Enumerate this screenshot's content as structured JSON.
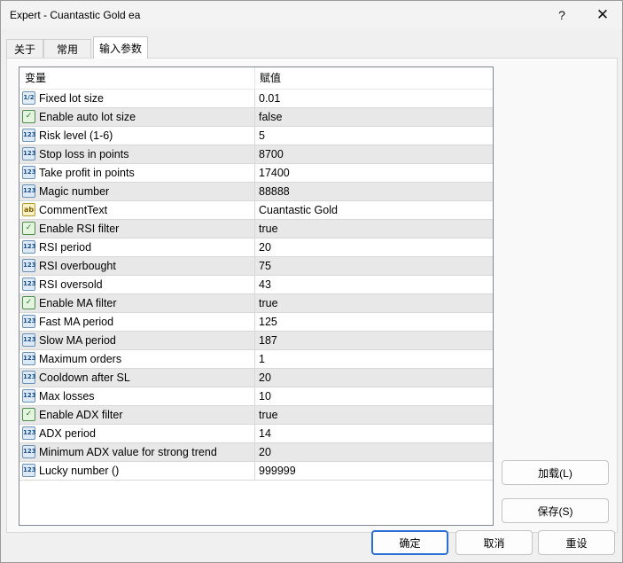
{
  "window": {
    "title": "Expert - Cuantastic Gold ea",
    "help": "?",
    "close": "✕"
  },
  "tabs": [
    "关于",
    "常用",
    "输入参数"
  ],
  "grid": {
    "headers": {
      "variable": "变量",
      "value": "赋值"
    },
    "rows": [
      {
        "type": "frac",
        "icon": "1/2",
        "name": "Fixed lot size",
        "value": "0.01"
      },
      {
        "type": "bool",
        "icon": "✓",
        "name": "Enable auto lot size",
        "value": "false"
      },
      {
        "type": "num",
        "icon": "123",
        "name": "Risk level (1-6)",
        "value": "5"
      },
      {
        "type": "num",
        "icon": "123",
        "name": "Stop loss in points",
        "value": "8700"
      },
      {
        "type": "num",
        "icon": "123",
        "name": "Take profit in points",
        "value": "17400"
      },
      {
        "type": "num",
        "icon": "123",
        "name": "Magic number",
        "value": "88888"
      },
      {
        "type": "str",
        "icon": "ab",
        "name": "CommentText",
        "value": "Cuantastic Gold"
      },
      {
        "type": "bool",
        "icon": "✓",
        "name": "Enable RSI filter",
        "value": "true"
      },
      {
        "type": "num",
        "icon": "123",
        "name": "RSI period",
        "value": "20"
      },
      {
        "type": "num",
        "icon": "123",
        "name": "RSI overbought",
        "value": "75"
      },
      {
        "type": "num",
        "icon": "123",
        "name": "RSI oversold",
        "value": "43"
      },
      {
        "type": "bool",
        "icon": "✓",
        "name": "Enable MA filter",
        "value": "true"
      },
      {
        "type": "num",
        "icon": "123",
        "name": "Fast MA period",
        "value": "125"
      },
      {
        "type": "num",
        "icon": "123",
        "name": "Slow MA period",
        "value": "187"
      },
      {
        "type": "num",
        "icon": "123",
        "name": "Maximum orders",
        "value": "1"
      },
      {
        "type": "num",
        "icon": "123",
        "name": "Cooldown after SL",
        "value": "20"
      },
      {
        "type": "num",
        "icon": "123",
        "name": "Max losses",
        "value": "10"
      },
      {
        "type": "bool",
        "icon": "✓",
        "name": "Enable ADX filter",
        "value": "true"
      },
      {
        "type": "num",
        "icon": "123",
        "name": "ADX period",
        "value": "14"
      },
      {
        "type": "num",
        "icon": "123",
        "name": "Minimum ADX value for strong trend",
        "value": "20"
      },
      {
        "type": "num",
        "icon": "123",
        "name": "Lucky number ()",
        "value": "999999"
      }
    ]
  },
  "buttons": {
    "load": "加载(L)",
    "save": "保存(S)",
    "ok": "确定",
    "cancel": "取消",
    "reset": "重设"
  }
}
